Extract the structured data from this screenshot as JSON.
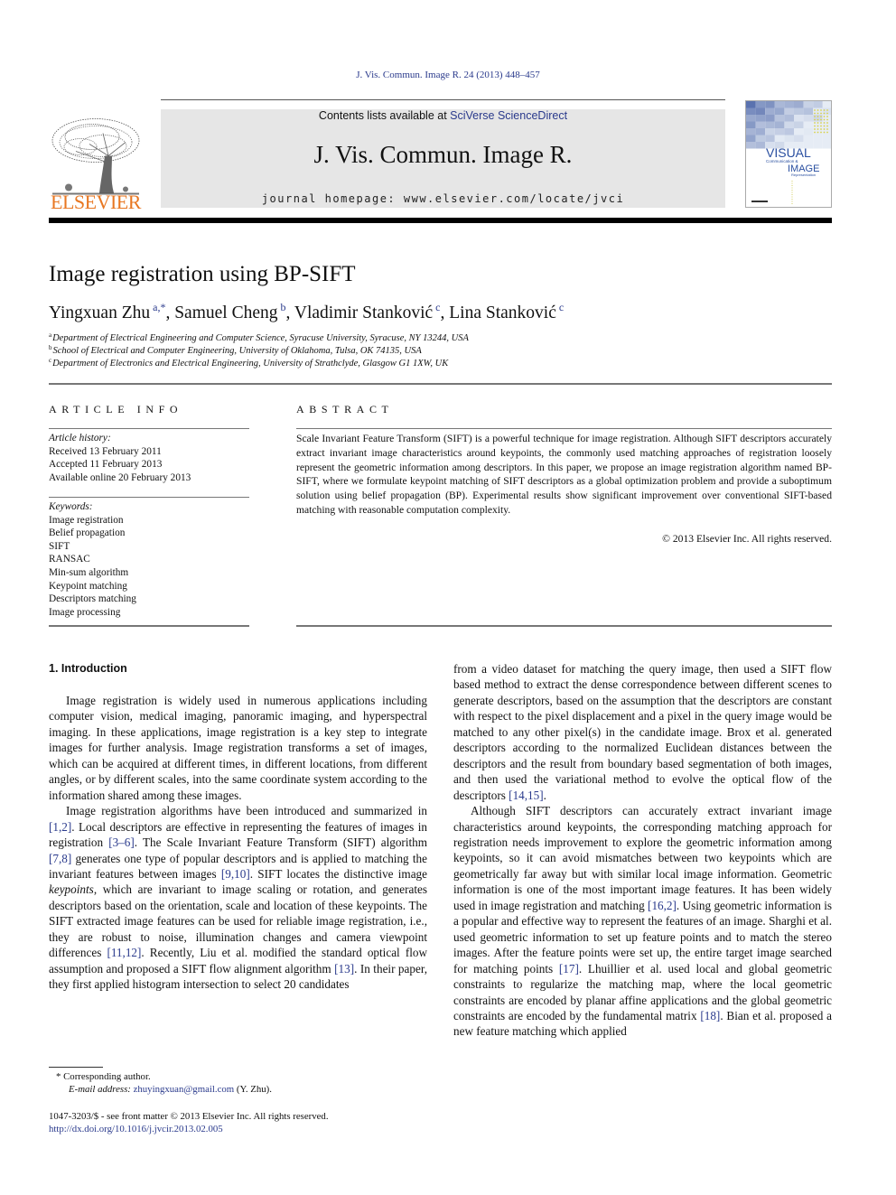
{
  "header": {
    "citation": "J. Vis. Commun. Image R. 24 (2013) 448–457",
    "publisher_logo_text": "ELSEVIER",
    "contents_prefix": "Contents lists available at ",
    "contents_link": "SciVerse ScienceDirect",
    "journal_title": "J. Vis. Commun. Image R.",
    "homepage_label": "journal homepage: ",
    "homepage_url": "www.elsevier.com/locate/jvci",
    "cover": {
      "line1": "VISUAL",
      "line2": "Communication &",
      "line3": "IMAGE",
      "line4": "Representation"
    },
    "colors": {
      "elsevier_orange": "#e87722",
      "link_blue": "#2a3a8c",
      "banner_gray": "#e6e6e6"
    }
  },
  "paper": {
    "title": "Image registration using BP-SIFT",
    "authors": [
      {
        "name": "Yingxuan Zhu",
        "sup": "a,*"
      },
      {
        "name": "Samuel Cheng",
        "sup": "b"
      },
      {
        "name": "Vladimir Stanković",
        "sup": "c"
      },
      {
        "name": "Lina Stanković",
        "sup": "c"
      }
    ],
    "affiliations": [
      {
        "mark": "a",
        "text": "Department of Electrical Engineering and Computer Science, Syracuse University, Syracuse, NY 13244, USA"
      },
      {
        "mark": "b",
        "text": "School of Electrical and Computer Engineering, University of Oklahoma, Tulsa, OK 74135, USA"
      },
      {
        "mark": "c",
        "text": "Department of Electronics and Electrical Engineering, University of Strathclyde, Glasgow G1 1XW, UK"
      }
    ]
  },
  "article_info": {
    "heading": "ARTICLE INFO",
    "history_label": "Article history:",
    "history": [
      "Received 13 February 2011",
      "Accepted 11 February 2013",
      "Available online 20 February 2013"
    ],
    "keywords_label": "Keywords:",
    "keywords": [
      "Image registration",
      "Belief propagation",
      "SIFT",
      "RANSAC",
      "Min-sum algorithm",
      "Keypoint matching",
      "Descriptors matching",
      "Image processing"
    ]
  },
  "abstract": {
    "heading": "ABSTRACT",
    "text": "Scale Invariant Feature Transform (SIFT) is a powerful technique for image registration. Although SIFT descriptors accurately extract invariant image characteristics around keypoints, the commonly used matching approaches of registration loosely represent the geometric information among descriptors. In this paper, we propose an image registration algorithm named BP-SIFT, where we formulate keypoint matching of SIFT descriptors as a global optimization problem and provide a suboptimum solution using belief propagation (BP). Experimental results show significant improvement over conventional SIFT-based matching with reasonable computation complexity.",
    "copyright": "© 2013 Elsevier Inc. All rights reserved."
  },
  "body": {
    "section_heading": "1. Introduction",
    "left_p1": "Image registration is widely used in numerous applications including computer vision, medical imaging, panoramic imaging, and hyperspectral imaging. In these applications, image registration is a key step to integrate images for further analysis. Image registration transforms a set of images, which can be acquired at different times, in different locations, from different angles, or by different scales, into the same coordinate system according to the information shared among these images.",
    "left_p2": [
      {
        "t": "Image registration algorithms have been introduced and summarized in "
      },
      {
        "t": "[1,2]",
        "ref": true
      },
      {
        "t": ". Local descriptors are effective in representing the features of images in registration "
      },
      {
        "t": "[3–6]",
        "ref": true
      },
      {
        "t": ". The Scale Invariant Feature Transform (SIFT) algorithm "
      },
      {
        "t": "[7,8]",
        "ref": true
      },
      {
        "t": " generates one type of popular descriptors and is applied to matching the invariant features between images "
      },
      {
        "t": "[9,10]",
        "ref": true
      },
      {
        "t": ". SIFT locates the distinctive image "
      },
      {
        "t": "keypoints",
        "em": true
      },
      {
        "t": ", which are invariant to image scaling or rotation, and generates descriptors based on the orientation, scale and location of these keypoints. The SIFT extracted image features can be used for reliable image registration, i.e., they are robust to noise, illumination changes and camera viewpoint differences "
      },
      {
        "t": "[11,12]",
        "ref": true
      },
      {
        "t": ". Recently, Liu et al. modified the standard optical flow assumption and proposed a SIFT flow alignment algorithm "
      },
      {
        "t": "[13]",
        "ref": true
      },
      {
        "t": ". In their paper, they first applied histogram intersection to select 20 candidates"
      }
    ],
    "right_p1": [
      {
        "t": "from a video dataset for matching the query image, then used a SIFT flow based method to extract the dense correspondence between different scenes to generate descriptors, based on the assumption that the descriptors are constant with respect to the pixel displacement and a pixel in the query image would be matched to any other pixel(s) in the candidate image. Brox et al. generated descriptors according to the normalized Euclidean distances between the descriptors and the result from boundary based segmentation of both images, and then used the variational method to evolve the optical flow of the descriptors "
      },
      {
        "t": "[14,15]",
        "ref": true
      },
      {
        "t": "."
      }
    ],
    "right_p2": [
      {
        "t": "Although SIFT descriptors can accurately extract invariant image characteristics around keypoints, the corresponding matching approach for registration needs improvement to explore the geometric information among keypoints, so it can avoid mismatches between two keypoints which are geometrically far away but with similar local image information. Geometric information is one of the most important image features. It has been widely used in image registration and matching "
      },
      {
        "t": "[16,2]",
        "ref": true
      },
      {
        "t": ". Using geometric information is a popular and effective way to represent the features of an image. Sharghi et al. used geometric information to set up feature points and to match the stereo images. After the feature points were set up, the entire target image searched for matching points "
      },
      {
        "t": "[17]",
        "ref": true
      },
      {
        "t": ". Lhuillier et al. used local and global geometric constraints to regularize the matching map, where the local geometric constraints are encoded by planar affine applications and the global geometric constraints are encoded by the fundamental matrix "
      },
      {
        "t": "[18]",
        "ref": true
      },
      {
        "t": ". Bian et al. proposed a new feature matching which applied"
      }
    ]
  },
  "footnotes": {
    "corresponding": "* Corresponding author.",
    "email_label": "E-mail address: ",
    "email": "zhuyingxuan@gmail.com",
    "email_suffix": " (Y. Zhu).",
    "issn": "1047-3203/$ - see front matter © 2013 Elsevier Inc. All rights reserved.",
    "doi": "http://dx.doi.org/10.1016/j.jvcir.2013.02.005"
  }
}
